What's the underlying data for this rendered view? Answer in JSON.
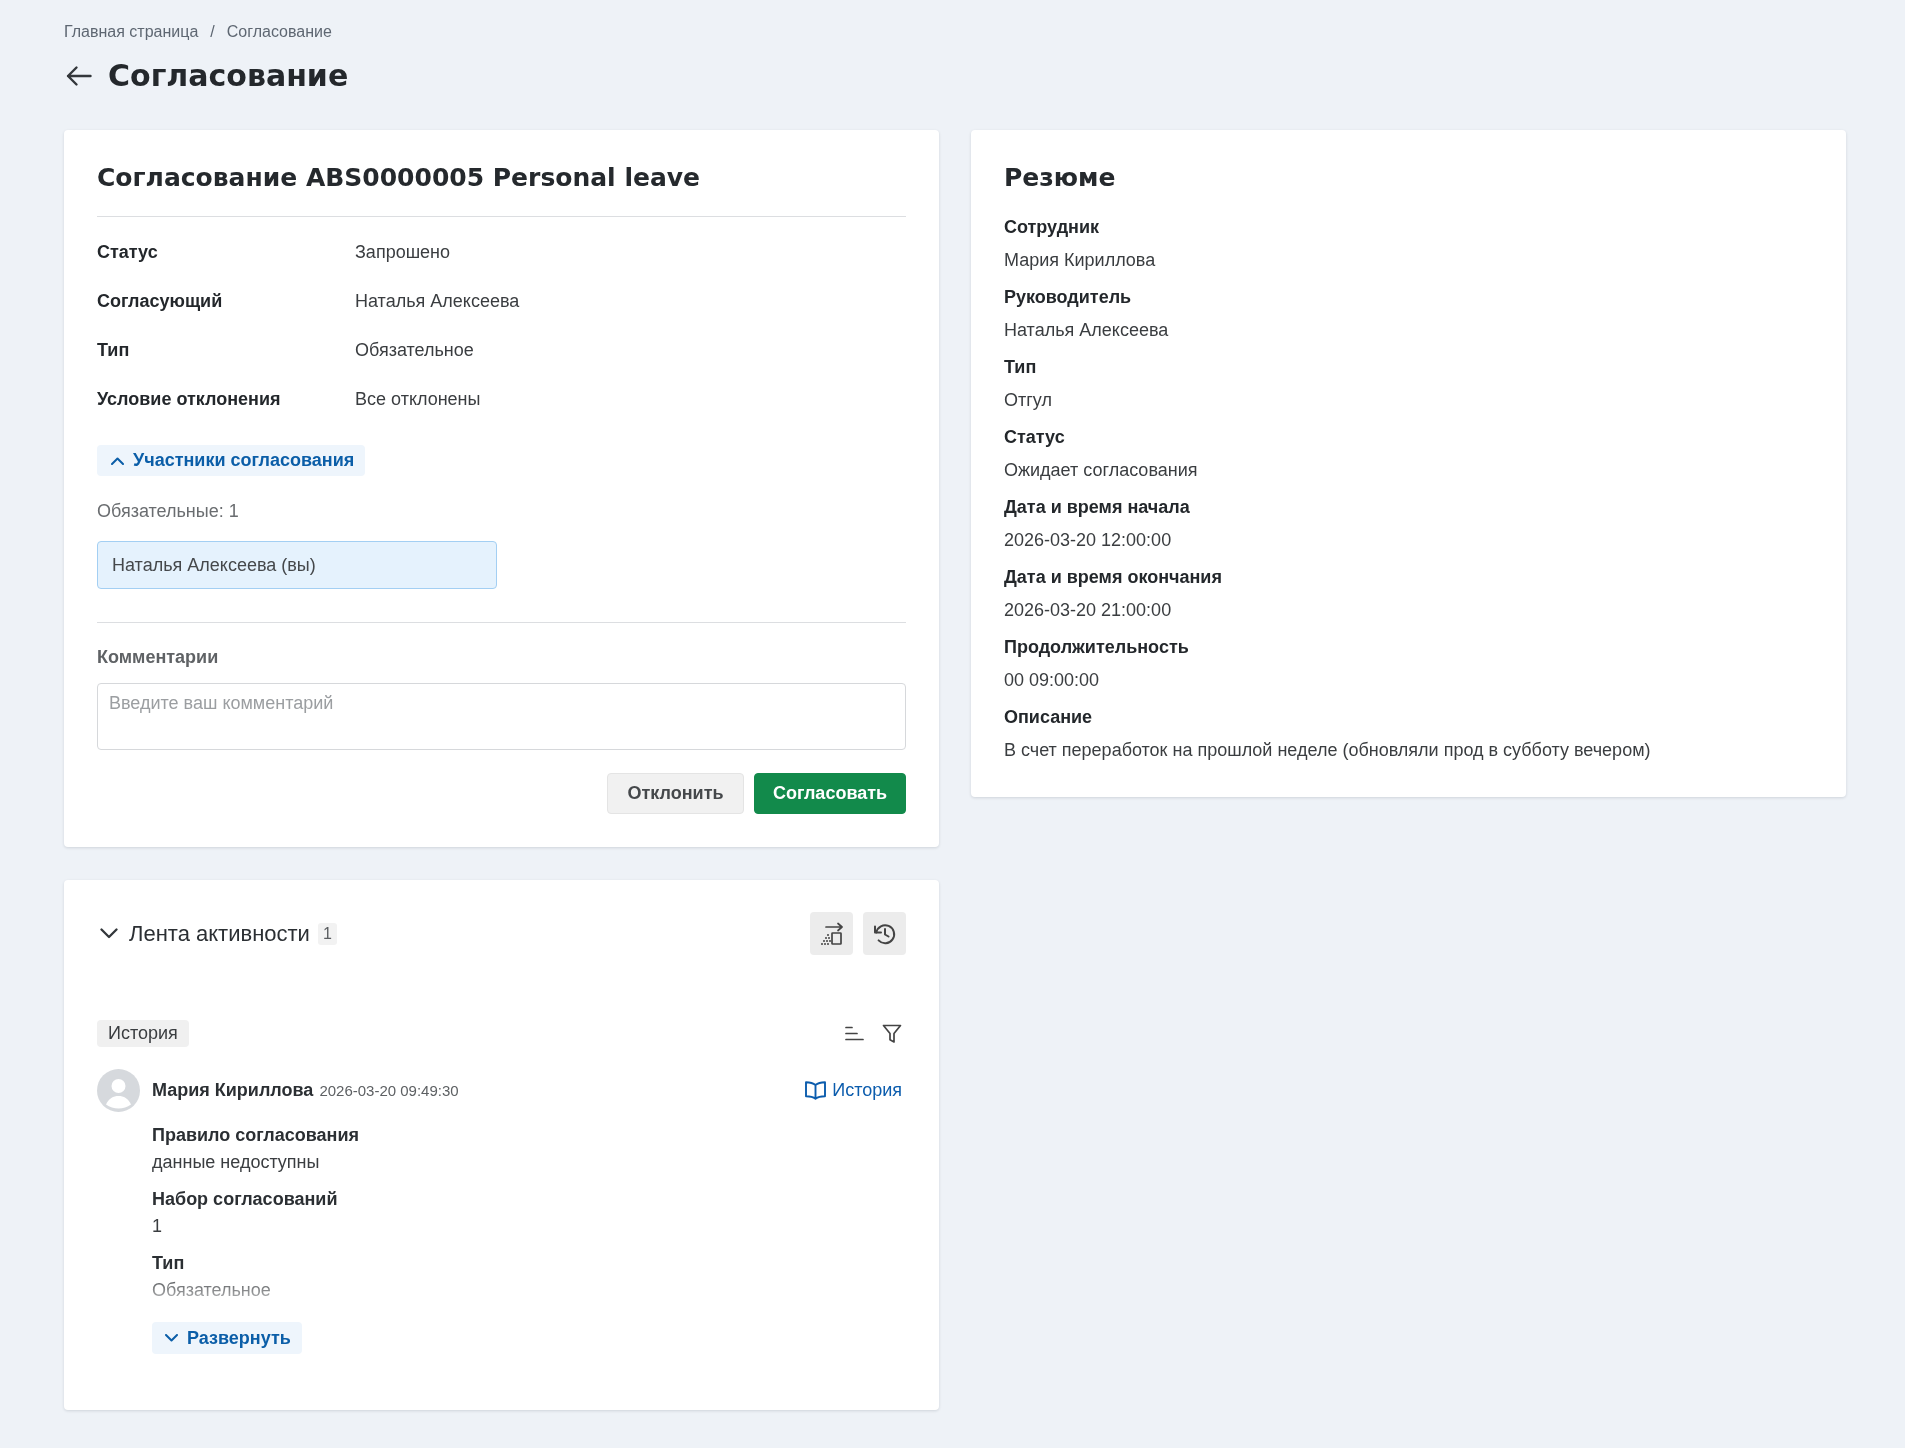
{
  "breadcrumbs": {
    "items": [
      {
        "label": "Главная страница"
      },
      {
        "label": "Согласование"
      }
    ],
    "separator": "/"
  },
  "page_title": "Согласование",
  "approval": {
    "title": "Согласование ABS0000005 Personal leave",
    "fields": [
      {
        "label": "Статус",
        "value": "Запрошено"
      },
      {
        "label": "Согласующий",
        "value": "Наталья Алексеева"
      },
      {
        "label": "Тип",
        "value": "Обязательное"
      },
      {
        "label": "Условие отклонения",
        "value": "Все отклонены"
      }
    ],
    "participants": {
      "toggle_label": "Участники согласования",
      "expanded": true,
      "required_label": "Обязательные: 1",
      "people": [
        {
          "name": "Наталья Алексеева (вы)"
        }
      ]
    },
    "comment": {
      "label": "Комментарии",
      "placeholder": "Введите ваш комментарий"
    },
    "actions": [
      {
        "label": "Отклонить",
        "kind": "secondary"
      },
      {
        "label": "Согласовать",
        "kind": "primary"
      }
    ]
  },
  "activity_feed": {
    "title": "Лента активности",
    "count": "1",
    "expanded": true,
    "tabs": [
      {
        "label": "История",
        "selected": true
      }
    ],
    "entries": [
      {
        "author": "Мария Кириллова",
        "timestamp": "2026-03-20 09:49:30",
        "link_label": "История",
        "details": [
          {
            "label": "Правило согласования",
            "value": "данные недоступны"
          },
          {
            "label": "Набор согласований",
            "value": "1"
          },
          {
            "label": "Тип",
            "value": "Обязательное"
          }
        ],
        "expanded": false,
        "expand_label": "Развернуть"
      }
    ]
  },
  "summary": {
    "title": "Резюме",
    "fields": [
      {
        "label": "Сотрудник",
        "value": "Мария Кириллова"
      },
      {
        "label": "Руководитель",
        "value": "Наталья Алексеева"
      },
      {
        "label": "Тип",
        "value": "Отгул"
      },
      {
        "label": "Статус",
        "value": "Ожидает согласования"
      },
      {
        "label": "Дата и время начала",
        "value": "2026-03-20 12:00:00"
      },
      {
        "label": "Дата и время окончания",
        "value": "2026-03-20 21:00:00"
      },
      {
        "label": "Продолжительность",
        "value": "00 09:00:00"
      },
      {
        "label": "Описание",
        "value": "В счет переработок на прошлой неделе (обновляли прод в субботу вечером)"
      }
    ]
  }
}
